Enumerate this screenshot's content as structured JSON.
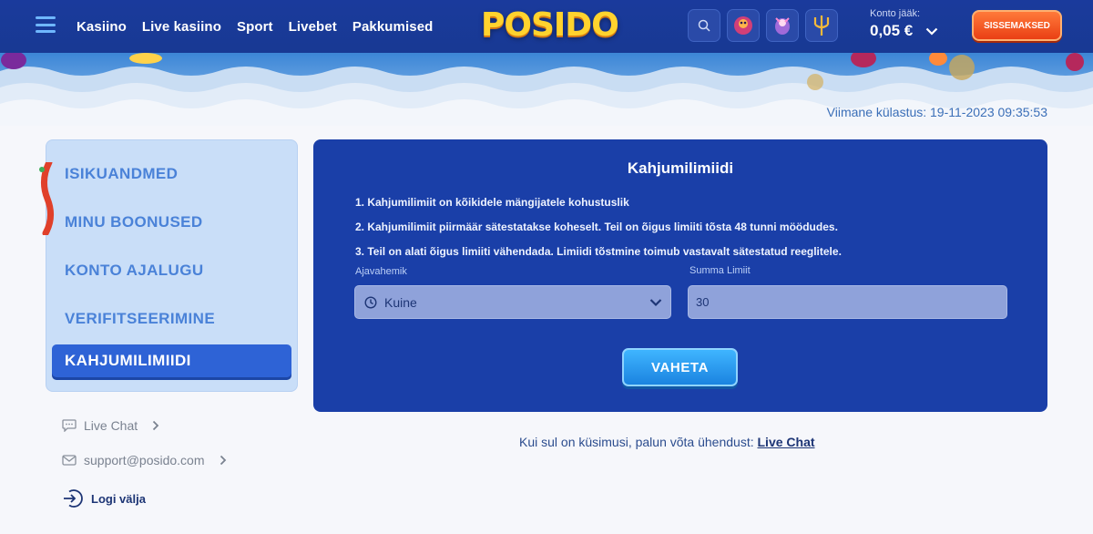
{
  "header": {
    "nav": [
      "Kasiino",
      "Live kasiino",
      "Sport",
      "Livebet",
      "Pakkumised"
    ],
    "logo_text": "POSIDO",
    "balance_label": "Konto jääk:",
    "balance_value": "0,05 €",
    "deposit_label": "SISSEMAKSED",
    "icons": [
      "menu-icon",
      "search-icon",
      "chevron-down-icon"
    ]
  },
  "last_visit": "Viimane külastus: 19-11-2023 09:35:53",
  "sidebar": {
    "items": [
      {
        "label": "ISIKUANDMED",
        "active": false
      },
      {
        "label": "MINU BOONUSED",
        "active": false
      },
      {
        "label": "KONTO AJALUGU",
        "active": false
      },
      {
        "label": "VERIFITSEERIMINE",
        "active": false
      },
      {
        "label": "KAHJUMILIMIIDI",
        "active": true
      }
    ],
    "live_chat": "Live Chat",
    "support_email": "support@posido.com",
    "logout": "Logi välja"
  },
  "panel": {
    "title": "Kahjumilimiidi",
    "rules": [
      "1. Kahjumilimiit on kõikidele mängijatele kohustuslik",
      "2. Kahjumilimiit piirmäär sätestatakse koheselt. Teil on õigus limiiti tõsta 48 tunni möödudes.",
      "3. Teil on alati õigus limiiti vähendada. Limiidi tõstmine toimub vastavalt sätestatud reeglitele."
    ],
    "period_label": "Ajavahemik",
    "period_value": "Kuine",
    "amount_label": "Summa Limiit",
    "amount_value": "30",
    "submit_label": "VAHETA"
  },
  "contact": {
    "text": "Kui sul on küsimusi, palun võta ühendust:",
    "link": "Live Chat"
  },
  "colors": {
    "header_bg": "#183993",
    "panel_bg": "#1a3fa8",
    "sidebar_bg": "#c9def8",
    "active_item": "#2e63d6",
    "deposit": "#ea3f14",
    "submit": "#1b83e0"
  }
}
